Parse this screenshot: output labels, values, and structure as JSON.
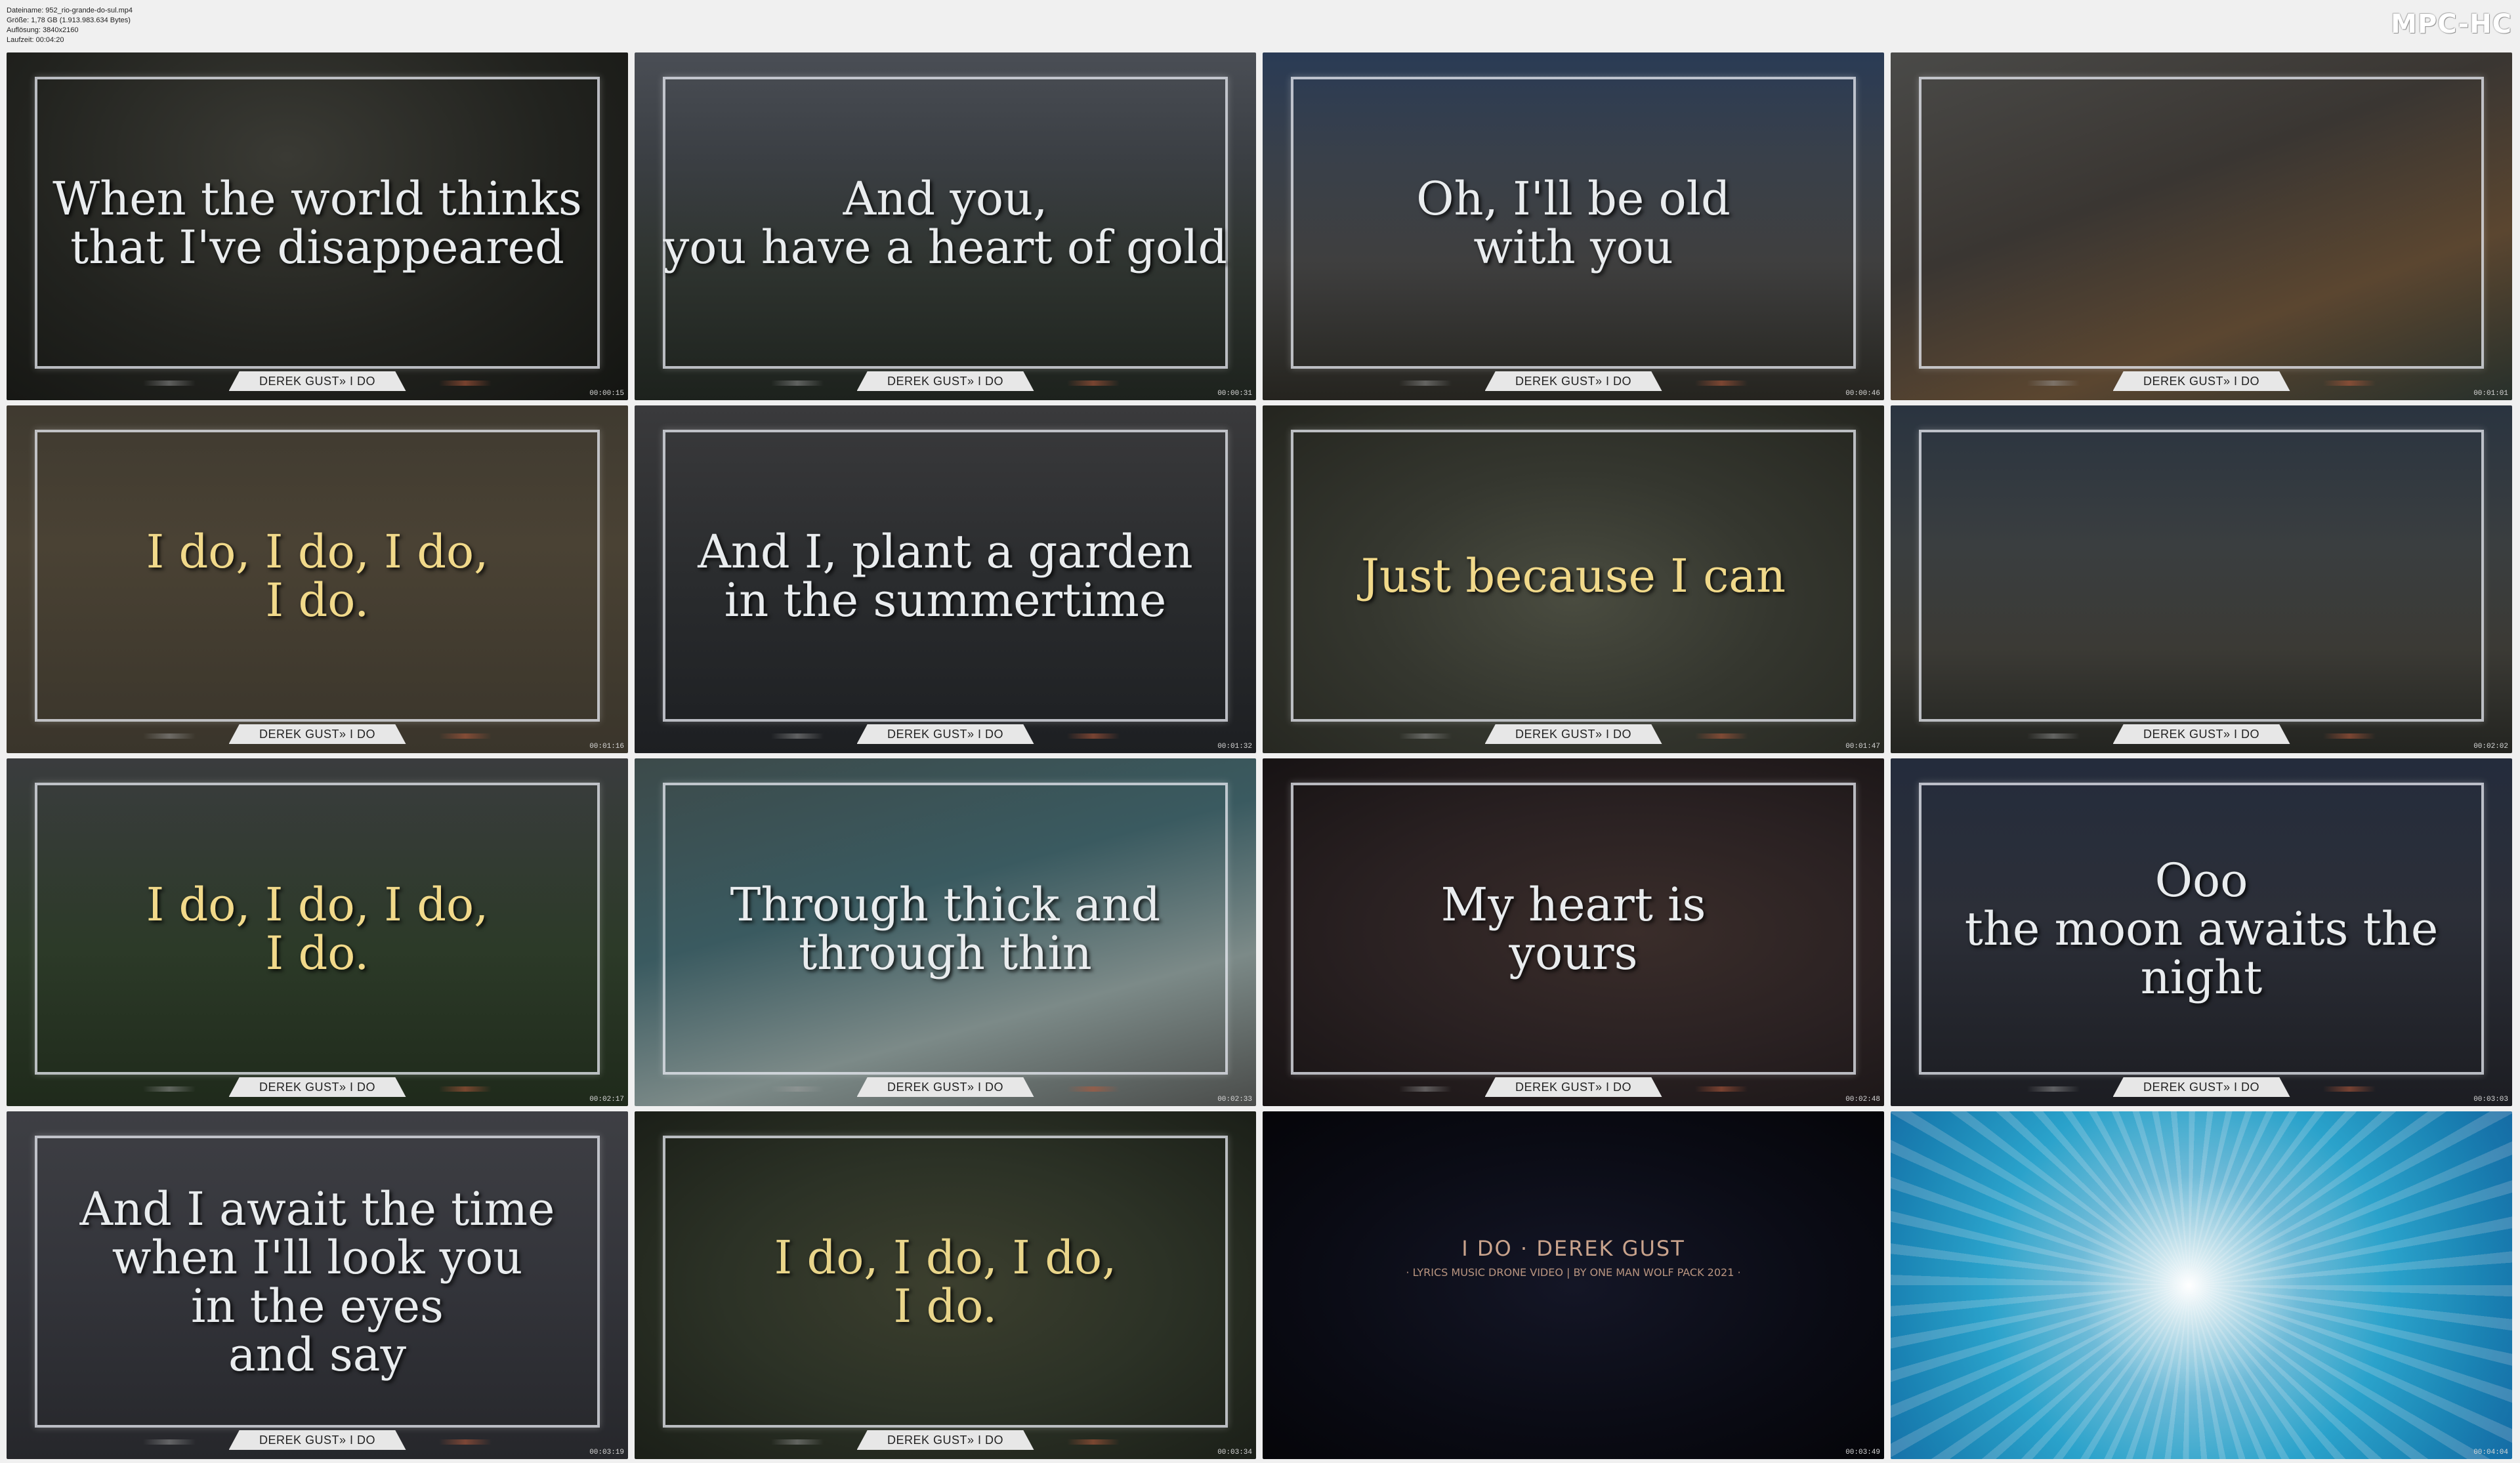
{
  "file_info": {
    "filename": "Dateiname: 952_rio-grande-do-sul.mp4",
    "size": "Größe: 1,78 GB (1.913.983.634 Bytes)",
    "resolution": "Auflösung: 3840x2160",
    "duration": "Laufzeit: 00:04:20"
  },
  "brand": "MPC-HC",
  "credit_text": "DEREK GUST» I DO",
  "tiles": [
    {
      "lyric": "When the world thinks\nthat I've disappeared",
      "timestamp": "00:00:15",
      "style": "white"
    },
    {
      "lyric": "And you,\nyou have a heart of gold",
      "timestamp": "00:00:31",
      "style": "white"
    },
    {
      "lyric": "Oh, I'll be old\nwith you",
      "timestamp": "00:00:46",
      "style": "white"
    },
    {
      "lyric": "",
      "timestamp": "00:01:01",
      "style": "white"
    },
    {
      "lyric": "I do, I do, I do,\nI do.",
      "timestamp": "00:01:16",
      "style": "gold"
    },
    {
      "lyric": "And I, plant a garden\nin the summertime",
      "timestamp": "00:01:32",
      "style": "white"
    },
    {
      "lyric": "Just because I can",
      "timestamp": "00:01:47",
      "style": "gold"
    },
    {
      "lyric": "",
      "timestamp": "00:02:02",
      "style": "white"
    },
    {
      "lyric": "I do, I do, I do,\nI do.",
      "timestamp": "00:02:17",
      "style": "gold"
    },
    {
      "lyric": "Through thick and\nthrough thin",
      "timestamp": "00:02:33",
      "style": "white"
    },
    {
      "lyric": "My heart is\nyours",
      "timestamp": "00:02:48",
      "style": "white"
    },
    {
      "lyric": "Ooo\nthe moon awaits the night",
      "timestamp": "00:03:03",
      "style": "white"
    },
    {
      "lyric": "And I await the time\nwhen I'll look you\nin the eyes\nand say",
      "timestamp": "00:03:19",
      "style": "white"
    },
    {
      "lyric": "I do, I do, I do,\nI do.",
      "timestamp": "00:03:34",
      "style": "gold"
    },
    {
      "lyric": "",
      "timestamp": "00:03:49",
      "style": "white"
    },
    {
      "lyric": "",
      "timestamp": "00:04:04",
      "style": "white"
    }
  ],
  "title_card": {
    "title": "I DO · DEREK GUST",
    "subtitle": "· LYRICS MUSIC DRONE VIDEO | BY ONE MAN WOLF PACK 2021 ·"
  }
}
